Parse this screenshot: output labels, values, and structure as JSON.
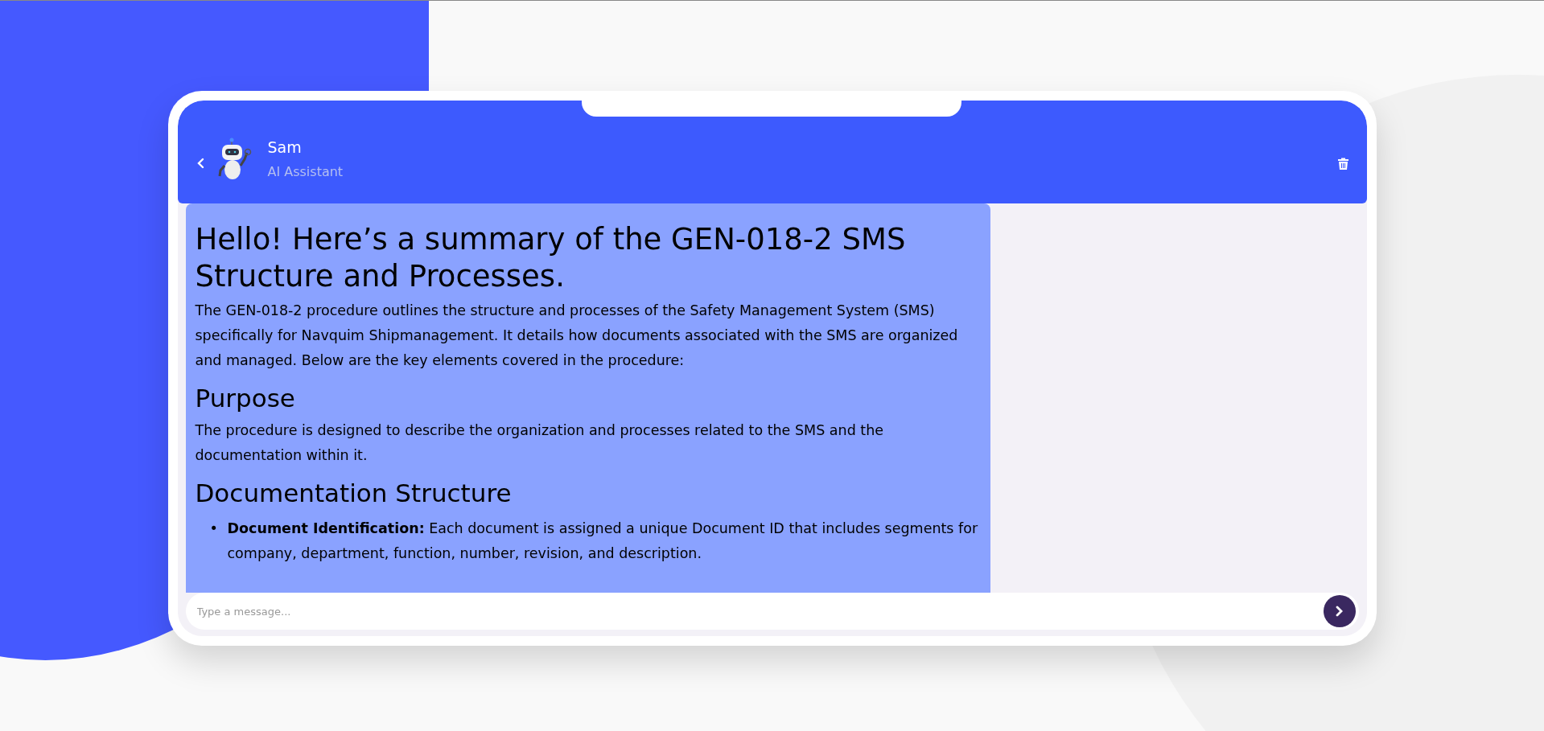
{
  "header": {
    "name": "Sam",
    "role": "AI Assistant"
  },
  "message": [
    {
      "kind": "h1",
      "text": "Hello! Here’s a summary of the GEN-018-2 SMS Structure and Processes."
    },
    {
      "kind": "p",
      "text": "The GEN-018-2 procedure outlines the structure and processes of the Safety Management System (SMS) specifically for Navquim Shipmanagement. It details how documents associated with the SMS are organized and managed. Below are the key elements covered in the procedure:"
    },
    {
      "kind": "h2",
      "text": "Purpose"
    },
    {
      "kind": "p",
      "text": "The procedure is designed to describe the organization and processes related to the SMS and the documentation within it."
    },
    {
      "kind": "h2",
      "text": "Documentation Structure"
    },
    {
      "kind": "ul",
      "items": [
        {
          "marker": "•",
          "text": "**Document Identification:** Each document is assigned a unique Document ID that includes segments for company, department, function, number, revision, and description."
        }
      ]
    }
  ],
  "composer": {
    "placeholder": "Type a message..."
  }
}
